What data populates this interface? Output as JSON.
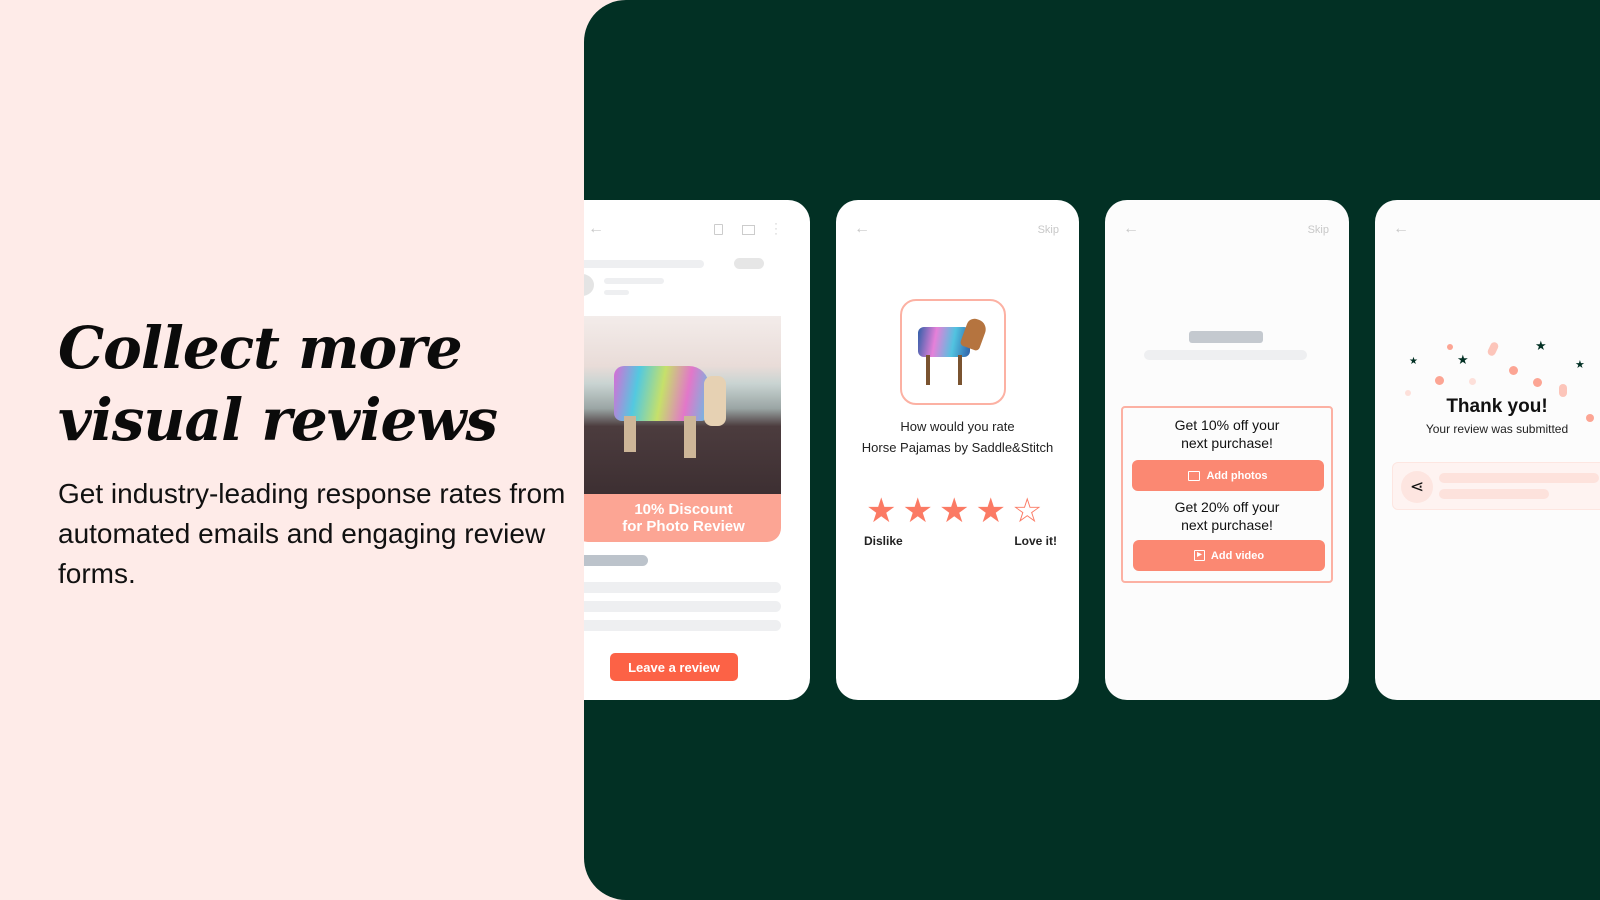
{
  "hero": {
    "title_line1": "Collect more",
    "title_line2": "visual reviews",
    "subtitle": "Get industry-leading response rates from automated emails and engaging review forms."
  },
  "email_card": {
    "banner_line1": "10% Discount",
    "banner_line2": "for Photo Review",
    "cta": "Leave a review",
    "icons": [
      "arrow-left-icon",
      "trash-icon",
      "mail-icon",
      "more-vertical-icon"
    ]
  },
  "rating_card": {
    "skip": "Skip",
    "question_line1": "How would you rate",
    "question_line2": "Horse Pajamas by Saddle&Stitch",
    "rating": 4,
    "max_rating": 5,
    "low_label": "Dislike",
    "high_label": "Love it!"
  },
  "media_card": {
    "skip": "Skip",
    "offer1_line1": "Get 10% off your",
    "offer1_line2": "next purchase!",
    "add_photos": "Add photos",
    "offer2_line1": "Get 20% off your",
    "offer2_line2": "next purchase!",
    "add_video": "Add video"
  },
  "thanks_card": {
    "title": "Thank you!",
    "subtitle": "Your review was submitted"
  },
  "colors": {
    "accent": "#fb7a64",
    "panel": "#023024",
    "background": "#feebe8"
  }
}
